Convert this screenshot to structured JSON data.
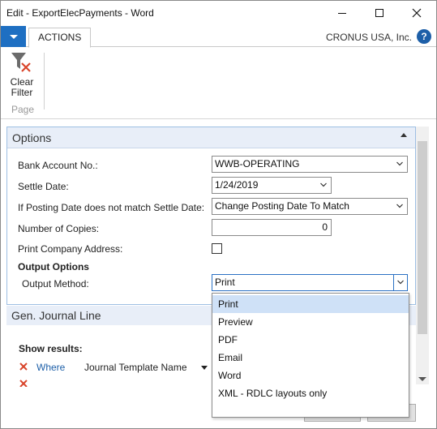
{
  "window": {
    "title": "Edit - ExportElecPayments - Word"
  },
  "ribbon": {
    "tab_actions": "ACTIONS",
    "company": "CRONUS USA, Inc.",
    "help": "?",
    "clear_filter_line1": "Clear",
    "clear_filter_line2": "Filter",
    "group_page": "Page"
  },
  "options": {
    "header": "Options",
    "bank_account_label": "Bank Account No.:",
    "bank_account_value": "WWB-OPERATING",
    "settle_date_label": "Settle Date:",
    "settle_date_value": "1/24/2019",
    "posting_mismatch_label": "If Posting Date does not match Settle Date:",
    "posting_mismatch_value": "Change Posting Date To Match",
    "copies_label": "Number of Copies:",
    "copies_value": "0",
    "print_company_label": "Print Company Address:",
    "print_company_checked": false,
    "output_options_label": "Output Options",
    "output_method_label": "Output Method:",
    "output_method_value": "Print"
  },
  "output_method_options": [
    "Print",
    "Preview",
    "PDF",
    "Email",
    "Word",
    "XML - RDLC layouts only"
  ],
  "output_method_selected_index": 0,
  "gen_journal": {
    "header": "Gen. Journal Line",
    "show_results": "Show results:",
    "where_label": "Where",
    "where_field": "Journal Template Name"
  },
  "colors": {
    "accent": "#1e6fc2",
    "link": "#1d5fa8",
    "remove_x": "#d9452b",
    "selection": "#cfe1f7"
  }
}
